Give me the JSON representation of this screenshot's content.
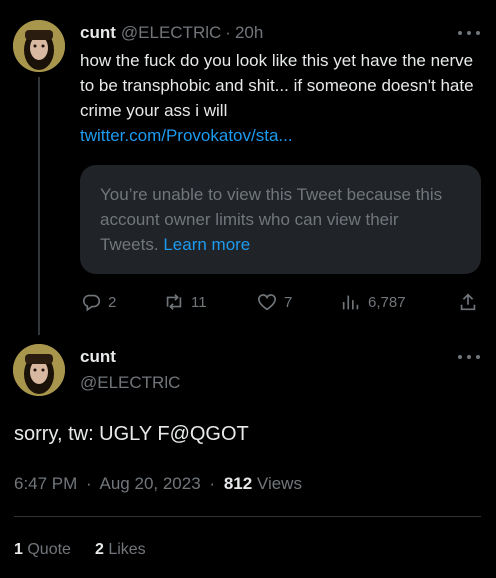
{
  "parent_tweet": {
    "display_name": "cunt",
    "handle": "@ELECTRlC",
    "separator": "·",
    "time": "20h",
    "text": "how the fuck do you look like this yet have the nerve to be transphobic and shit... if someone doesn't hate crime your ass i will",
    "link_text": "twitter.com/Provokatov/sta...",
    "quoted_notice": {
      "text": "You’re unable to view this Tweet because this account owner limits who can view their Tweets.",
      "link_text": "Learn more"
    },
    "actions": {
      "replies": "2",
      "retweets": "11",
      "likes": "7",
      "views": "6,787"
    }
  },
  "focal_tweet": {
    "display_name": "cunt",
    "handle": "@ELECTRlC",
    "text": "sorry, tw: UGLY F@QGOT",
    "time": "6:47 PM",
    "separator": "·",
    "date": "Aug 20, 2023",
    "views_count": "812",
    "views_label": "Views",
    "stats": [
      {
        "count": "1",
        "label": "Quote"
      },
      {
        "count": "2",
        "label": "Likes"
      }
    ]
  },
  "icons": {
    "reply": "reply-icon",
    "retweet": "retweet-icon",
    "like": "heart-icon",
    "views": "views-bar-chart-icon",
    "share": "share-icon",
    "more": "more-dots-icon"
  },
  "colors": {
    "background": "#000000",
    "text": "#e7e9ea",
    "muted": "#71767b",
    "link": "#1d9bf0",
    "card": "#202327",
    "divider": "#2f3336"
  }
}
